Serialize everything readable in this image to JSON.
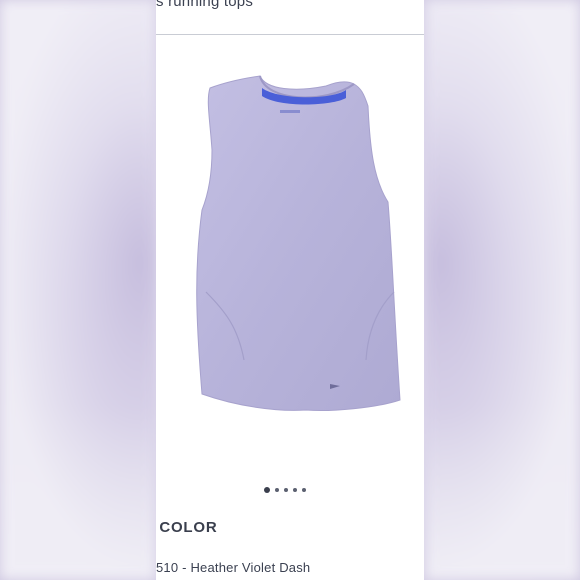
{
  "page": {
    "title_fragment": "s running tops"
  },
  "product": {
    "image_icon": "tank-top-image",
    "brand_icon": "brooks-logo-icon",
    "colors": {
      "garment": "#b9b5dc",
      "neck_tape": "#4a5fd8"
    }
  },
  "carousel": {
    "dot_count": 5,
    "active_index": 0
  },
  "color_section": {
    "heading_fragment": "' COLOR",
    "selected_value": "510 - Heather Violet Dash"
  }
}
